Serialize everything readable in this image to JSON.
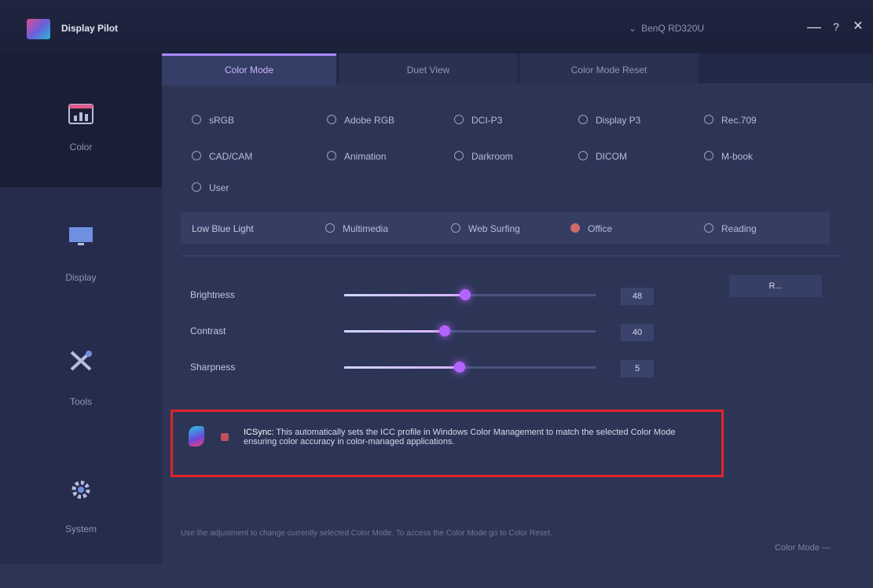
{
  "app": {
    "title": "Display Pilot"
  },
  "titlebar": {
    "monitor": "BenQ RD320U",
    "minimize": "—",
    "help": "?",
    "close": "✕"
  },
  "sidebar": {
    "items": [
      {
        "label": "Color",
        "icon": "color-chart-icon"
      },
      {
        "label": "Display",
        "icon": "monitor-icon"
      },
      {
        "label": "Tools",
        "icon": "tools-icon"
      },
      {
        "label": "System",
        "icon": "gear-icon"
      }
    ]
  },
  "tabs": [
    {
      "label": "Color Mode"
    },
    {
      "label": "Duet View"
    },
    {
      "label": "Color Mode Reset"
    }
  ],
  "color_modes": {
    "row1": [
      "sRGB",
      "Adobe RGB",
      "DCI-P3",
      "Display P3",
      "Rec.709"
    ],
    "row2": [
      "CAD/CAM",
      "Animation",
      "Darkroom",
      "DICOM",
      "M-book"
    ],
    "row3": [
      "User"
    ]
  },
  "low_blue_light": {
    "title": "Low Blue Light",
    "options": [
      "Multimedia",
      "Web Surfing",
      "Office",
      "Reading"
    ],
    "selected": "Office"
  },
  "sliders": [
    {
      "label": "Brightness",
      "value": "48",
      "fraction": 0.48
    },
    {
      "label": "Contrast",
      "value": "40",
      "fraction": 0.4
    },
    {
      "label": "Sharpness",
      "value": "5",
      "fraction": 0.46
    }
  ],
  "reset": {
    "label": "R..."
  },
  "icc": {
    "brand": "ICSync:",
    "text": "This automatically sets the ICC profile in Windows Color Management to match the selected Color Mode ensuring color accuracy in color-managed applications."
  },
  "footer": {
    "note": "Use the adjustment to change currently selected Color Mode. To access the Color Mode go to Color Reset.",
    "link": "Color Mode —"
  },
  "colors": {
    "accent": "#a98aff",
    "highlight_box": "#e0232b",
    "knob": "#b463ff"
  }
}
